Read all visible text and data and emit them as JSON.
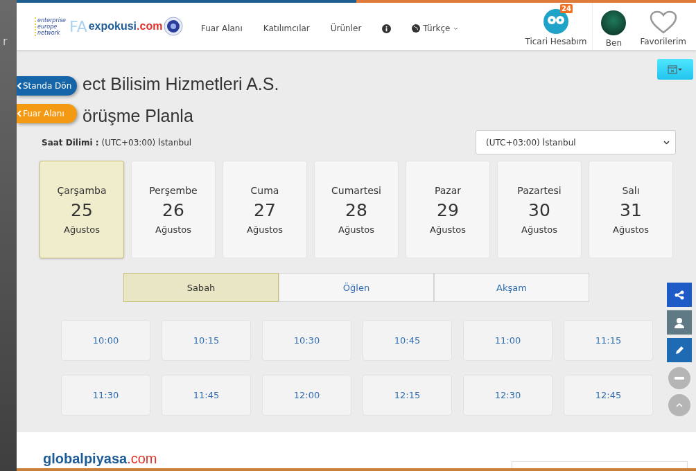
{
  "backdrop": {
    "text": "r"
  },
  "header": {
    "eu_logo": "enterprise europe network",
    "fairs": "FA",
    "brand": {
      "name": "expokusi",
      "tld": ".com"
    },
    "nav": [
      {
        "kind": "link",
        "label": "Fuar Alanı"
      },
      {
        "kind": "link",
        "label": "Katılımcılar"
      },
      {
        "kind": "link",
        "label": "Ürünler"
      },
      {
        "kind": "info"
      },
      {
        "kind": "language",
        "label": "Türkçe"
      }
    ],
    "account": {
      "label": "Ticari Hesabım",
      "badge": "24"
    },
    "profile": {
      "label": "Ben"
    },
    "favorites": {
      "label": "Favorilerim"
    }
  },
  "side_buttons": [
    {
      "label": "Standa Dön",
      "color": "#1565a8"
    },
    {
      "label": "Fuar Alanı",
      "color": "#f39a12"
    }
  ],
  "company_title": "ect Bilisim Hizmetleri A.S.",
  "page_title": "örüşme Planla",
  "timezone": {
    "label": "Saat Dilimi :",
    "value": "(UTC+03:00) İstanbul",
    "select": "(UTC+03:00) İstanbul"
  },
  "days": [
    {
      "weekday": "Çarşamba",
      "day": "25",
      "month": "Ağustos",
      "selected": true
    },
    {
      "weekday": "Perşembe",
      "day": "26",
      "month": "Ağustos",
      "selected": false
    },
    {
      "weekday": "Cuma",
      "day": "27",
      "month": "Ağustos",
      "selected": false
    },
    {
      "weekday": "Cumartesi",
      "day": "28",
      "month": "Ağustos",
      "selected": false
    },
    {
      "weekday": "Pazar",
      "day": "29",
      "month": "Ağustos",
      "selected": false
    },
    {
      "weekday": "Pazartesi",
      "day": "30",
      "month": "Ağustos",
      "selected": false
    },
    {
      "weekday": "Salı",
      "day": "31",
      "month": "Ağustos",
      "selected": false
    }
  ],
  "periods": [
    {
      "label": "Sabah",
      "selected": true
    },
    {
      "label": "Öğlen",
      "selected": false
    },
    {
      "label": "Akşam",
      "selected": false
    }
  ],
  "slots": [
    "10:00",
    "10:15",
    "10:30",
    "10:45",
    "11:00",
    "11:15",
    "11:30",
    "11:45",
    "12:00",
    "12:15",
    "12:30",
    "12:45"
  ],
  "tools": [
    {
      "kind": "share",
      "color": "#1e5bc6"
    },
    {
      "kind": "support",
      "color": "#5f7a85"
    },
    {
      "kind": "edit",
      "color": "#1f6bb3"
    },
    {
      "kind": "minimize",
      "color": "#b5b5b5"
    },
    {
      "kind": "up",
      "color": "#b5b5b5"
    }
  ],
  "footer": {
    "brand": {
      "name": "globalpiyasa",
      "tld": ".com"
    }
  }
}
